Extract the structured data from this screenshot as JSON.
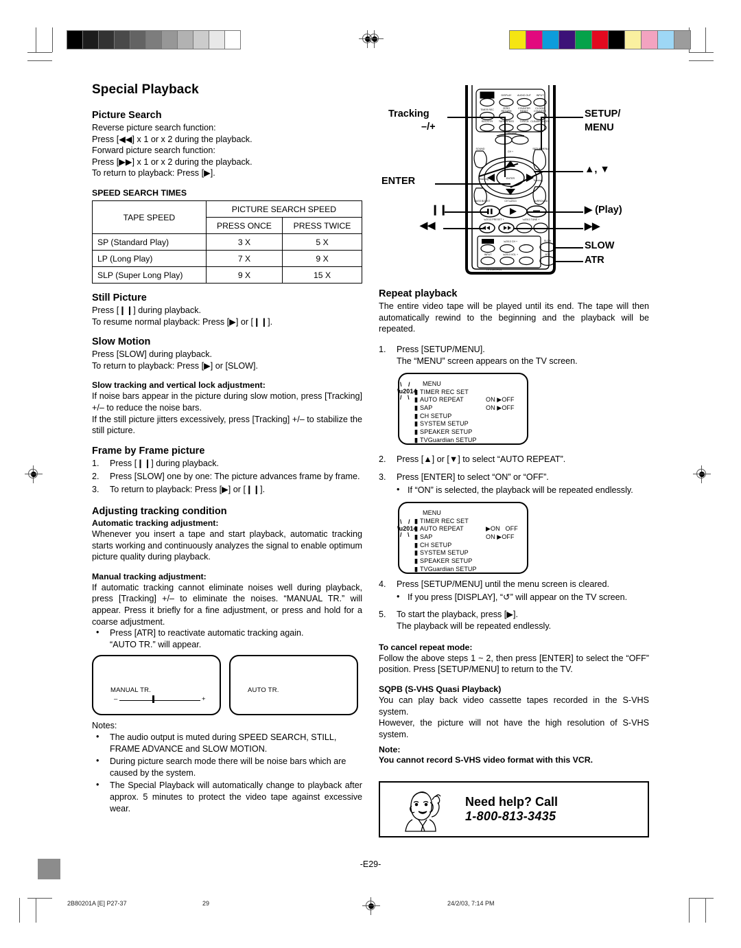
{
  "document": {
    "title": "Special Playback",
    "page_marker": "-E29-",
    "footer": {
      "job_code": "2B80201A [E] P27-37",
      "page_number": "29",
      "timestamp": "24/2/03, 7:14 PM"
    }
  },
  "left_column": {
    "picture_search": {
      "heading": "Picture Search",
      "lines": [
        "Reverse picture search function:",
        "Press [◀◀] x 1 or x 2 during the playback.",
        "Forward picture search function:",
        "Press [▶▶] x 1 or x 2 during the playback.",
        "To return to playback: Press [▶]."
      ]
    },
    "speed_table": {
      "caption": "SPEED SEARCH TIMES",
      "col_tape": "TAPE SPEED",
      "col_group": "PICTURE SEARCH SPEED",
      "col_once": "PRESS ONCE",
      "col_twice": "PRESS TWICE",
      "rows": [
        {
          "speed": "SP (Standard Play)",
          "once": "3 X",
          "twice": "5 X"
        },
        {
          "speed": "LP (Long Play)",
          "once": "7 X",
          "twice": "9 X"
        },
        {
          "speed": "SLP (Super Long Play)",
          "once": "9 X",
          "twice": "15 X"
        }
      ]
    },
    "still_picture": {
      "heading": "Still Picture",
      "line1": "Press [❙❙] during playback.",
      "line2": "To resume normal playback: Press [▶] or [❙❙]."
    },
    "slow_motion": {
      "heading": "Slow Motion",
      "line1": "Press [SLOW] during playback.",
      "line2": "To return to playback: Press [▶] or [SLOW]."
    },
    "slow_tracking": {
      "heading": "Slow tracking and vertical lock adjustment:",
      "para1": "If noise bars appear in the picture during slow motion, press [Tracking] +/– to reduce the noise bars.",
      "para2": "If the still picture jitters excessively, press [Tracking] +/– to stabilize the still picture."
    },
    "frame_by_frame": {
      "heading": "Frame by Frame picture",
      "steps": [
        "Press [❙❙] during playback.",
        "Press [SLOW] one by one: The picture advances frame by frame.",
        "To return to playback: Press [▶] or [❙❙]."
      ]
    },
    "tracking": {
      "heading": "Adjusting tracking condition",
      "auto_heading": "Automatic tracking adjustment:",
      "auto_para": "Whenever you insert a tape and start playback, automatic tracking starts working and continuously analyzes the signal to enable optimum picture quality during playback.",
      "manual_heading": "Manual tracking adjustment:",
      "manual_para": "If automatic tracking cannot eliminate noises well during playback, press [Tracking] +/– to eliminate the noises. “MANUAL TR.” will appear. Press it briefly for a fine adjustment, or press and hold for a coarse adjustment.",
      "manual_bullet_l1": "Press [ATR] to reactivate automatic tracking again.",
      "manual_bullet_l2": "“AUTO TR.” will appear."
    },
    "osd_manual": {
      "label": "MANUAL TR.",
      "minus": "–",
      "plus": "+"
    },
    "osd_auto": {
      "label": "AUTO TR."
    },
    "notes": {
      "heading": "Notes:",
      "items": [
        "The audio output is muted during SPEED SEARCH, STILL, FRAME ADVANCE and SLOW MOTION.",
        "During picture search mode there will be noise bars which are caused by the system.",
        "The Special Playback will automatically change to playback after approx. 5 minutes to protect the video tape against excessive wear."
      ]
    }
  },
  "remote": {
    "callouts_left": [
      {
        "label": "Tracking",
        "sub": "–/+"
      },
      {
        "label": "ENTER"
      },
      {
        "label": "❙❙"
      },
      {
        "label": "◀◀"
      }
    ],
    "callouts_right": [
      {
        "label": "SETUP/"
      },
      {
        "label": "MENU"
      },
      {
        "label": "▲, ▼"
      },
      {
        "label": "▶  (Play)"
      },
      {
        "label": "▶▶"
      },
      {
        "label": "SLOW"
      },
      {
        "label": "ATR"
      }
    ],
    "keys_row1": [
      "POWER",
      "DISPLAY",
      "AUDIO OUT",
      "INPUT"
    ],
    "keys_row2": [
      "TIMER REC",
      "ZERO RETURN",
      "COUNTER RESET",
      "CLOCK/ COUNTER"
    ],
    "keys_row3": [
      "REC/OTR",
      "TAPE SPEED",
      "TV/VCR",
      "CLEAR/CANCEL"
    ],
    "keys_mid": [
      "VOLUME",
      "SOUND",
      "CH +",
      "SETUP/MENU",
      "Tracking",
      "ENTER",
      "Tracking",
      "BASS BOOST",
      "CH –",
      "SURROUND"
    ],
    "keys_transport": [
      "– PRESET +",
      "– TUNE +"
    ],
    "keys_tv": [
      "POWER",
      "–  CH  +",
      "SLOW",
      "INPUT",
      "–  VOL  +",
      "ATR",
      "TV CONTROL"
    ]
  },
  "right_column": {
    "repeat": {
      "heading": "Repeat playback",
      "intro": "The entire video tape will be played until its end. The tape will then automatically rewind to the beginning and the playback will be repeated.",
      "step1_l1": "Press [SETUP/MENU].",
      "step1_l2": "The “MENU” screen appears on the TV screen.",
      "step2": "Press [▲] or [▼] to select “AUTO REPEAT”.",
      "step3": "Press [ENTER] to select “ON” or “OFF”.",
      "step3_bullet": "If “ON” is selected, the playback will be repeated endlessly.",
      "step4": "Press [SETUP/MENU] until the menu screen is cleared.",
      "step4_bullet": "If you press [DISPLAY], “↺” will appear on the TV screen.",
      "step5_l1": "To start the playback, press [▶].",
      "step5_l2": "The playback will be repeated endlessly."
    },
    "osd_menu1": {
      "title": "MENU",
      "rows": [
        {
          "text": "TIMER REC SET",
          "value": ""
        },
        {
          "text": "AUTO REPEAT",
          "value": "ON ▶OFF"
        },
        {
          "text": "SAP",
          "value": "ON ▶OFF"
        },
        {
          "text": "CH SETUP",
          "value": ""
        },
        {
          "text": "SYSTEM SETUP",
          "value": ""
        },
        {
          "text": "SPEAKER SETUP",
          "value": ""
        },
        {
          "text": "TVGuardian SETUP",
          "value": ""
        }
      ]
    },
    "osd_menu2": {
      "title": "MENU",
      "rows": [
        {
          "text": "TIMER REC SET",
          "value": ""
        },
        {
          "text": "AUTO REPEAT",
          "value": "▶ON   OFF"
        },
        {
          "text": "SAP",
          "value": "ON ▶OFF"
        },
        {
          "text": "CH SETUP",
          "value": ""
        },
        {
          "text": "SYSTEM SETUP",
          "value": ""
        },
        {
          "text": "SPEAKER SETUP",
          "value": ""
        },
        {
          "text": "TVGuardian SETUP",
          "value": ""
        }
      ]
    },
    "cancel": {
      "heading": "To cancel repeat mode:",
      "para": "Follow the above steps 1 ~ 2, then press [ENTER] to select the “OFF” position. Press [SETUP/MENU] to return to the TV."
    },
    "sqpb": {
      "heading": "SQPB (S-VHS Quasi Playback)",
      "para1": "You can play back video cassette tapes recorded in the S-VHS system.",
      "para2": "However, the picture will not have the high resolution of S-VHS system."
    },
    "note": {
      "heading": "Note:",
      "text": "You cannot record S-VHS video format with this VCR."
    },
    "need_help": {
      "line1": "Need help? Call",
      "line2": "1-800-813-3435"
    }
  },
  "print_marks": {
    "grayscale_wedge": [
      "#000000",
      "#1c1c1c",
      "#333333",
      "#4a4a4a",
      "#636363",
      "#7d7d7d",
      "#979797",
      "#b2b2b2",
      "#cccccc",
      "#e8e8e8",
      "#ffffff"
    ],
    "color_bar": [
      "#f5e512",
      "#e2097e",
      "#0d9ddb",
      "#3c1278",
      "#05a24a",
      "#e2091f",
      "#000000",
      "#faf0a0",
      "#f3a3c0",
      "#9ed7f5",
      "#9c9c9c"
    ]
  }
}
